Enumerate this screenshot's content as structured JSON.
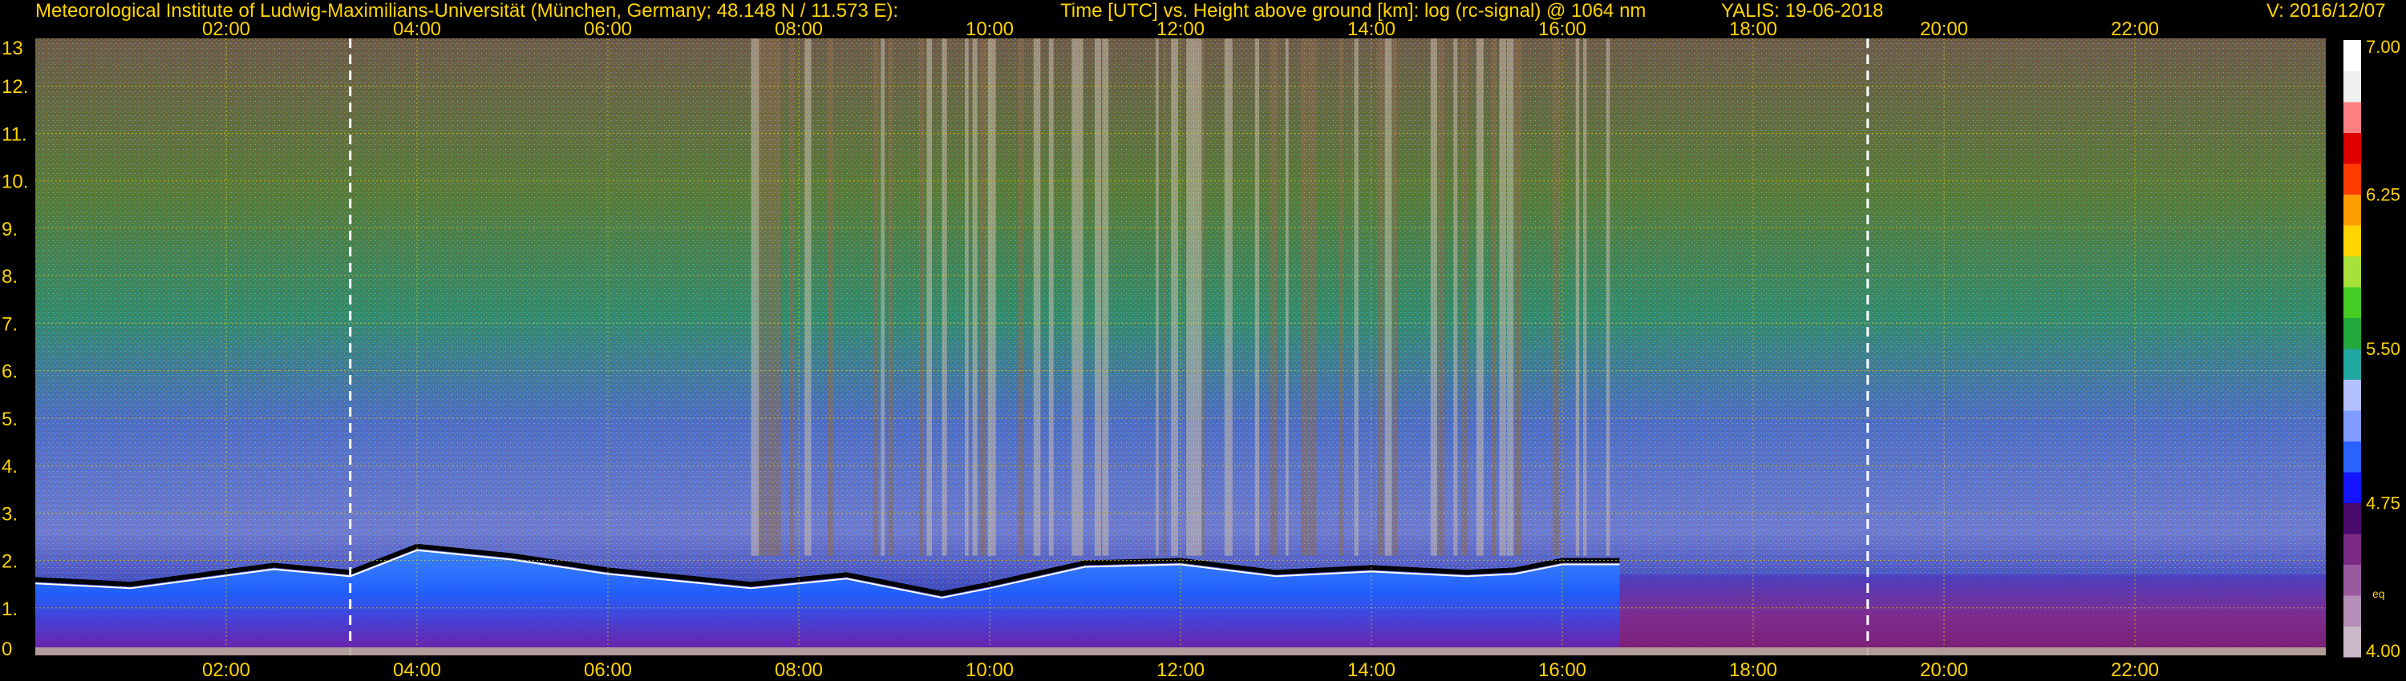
{
  "header": {
    "institute": "Meteorological Institute of Ludwig-Maximilians-Universität (München, Germany; 48.148 N / 11.573 E):",
    "description": "Time [UTC] vs. Height above ground [km]: log (rc-signal) @ 1064 nm",
    "instrument_date": "YALIS: 19-06-2018",
    "version": "V: 2016/12/07"
  },
  "colors": {
    "label": "#ffd400",
    "grid": "#d8c400",
    "marker": "#ffffff",
    "background": "#000000"
  },
  "chart_data": {
    "type": "heatmap",
    "title": "Time [UTC] vs. Height above ground [km]: log (rc-signal) @ 1064 nm",
    "x_unit": "hours UTC",
    "y_unit": "km",
    "x_range": [
      0,
      24
    ],
    "y_range": [
      0,
      13
    ],
    "x_tick_values": [
      2,
      4,
      6,
      8,
      10,
      12,
      14,
      16,
      18,
      20,
      22
    ],
    "x_tick_labels": [
      "02:00",
      "04:00",
      "06:00",
      "08:00",
      "10:00",
      "12:00",
      "14:00",
      "16:00",
      "18:00",
      "20:00",
      "22:00"
    ],
    "y_tick_values": [
      0,
      1,
      2,
      3,
      4,
      5,
      6,
      7,
      8,
      9,
      10,
      11,
      12,
      13
    ],
    "y_tick_labels": [
      "0",
      "1.",
      "2.",
      "3.",
      "4.",
      "5.",
      "6.",
      "7.",
      "8.",
      "9.",
      "10.",
      "11.",
      "12.",
      "13"
    ],
    "grid": true,
    "marker_lines_hours": [
      3.3,
      19.2
    ],
    "colorbar": {
      "range": [
        4.0,
        7.0
      ],
      "tick_values": [
        4.0,
        4.75,
        5.5,
        6.25,
        7.0
      ],
      "tick_labels": [
        "4.00",
        "4.75",
        "5.50",
        "6.25",
        "7.00"
      ],
      "note": "eq",
      "colors": [
        "#c9b8c9",
        "#b48eb8",
        "#9a5a9e",
        "#7a2a82",
        "#4a0a6e",
        "#1414ff",
        "#2a62ff",
        "#7f9bff",
        "#b3c0ff",
        "#20a8a0",
        "#21a83a",
        "#44cc22",
        "#a8e03a",
        "#ffd400",
        "#ff9c00",
        "#ff3b00",
        "#e00000",
        "#ff8080",
        "#f0f0f0",
        "#ffffff"
      ]
    },
    "boundary_layer_top_km": [
      [
        0.0,
        1.6
      ],
      [
        1.0,
        1.5
      ],
      [
        2.5,
        1.9
      ],
      [
        3.3,
        1.75
      ],
      [
        4.0,
        2.3
      ],
      [
        5.0,
        2.1
      ],
      [
        6.0,
        1.8
      ],
      [
        7.5,
        1.5
      ],
      [
        8.5,
        1.7
      ],
      [
        9.5,
        1.3
      ],
      [
        10.0,
        1.5
      ],
      [
        11.0,
        1.95
      ],
      [
        12.0,
        2.0
      ],
      [
        13.0,
        1.75
      ],
      [
        14.0,
        1.85
      ],
      [
        15.0,
        1.75
      ],
      [
        15.5,
        1.8
      ],
      [
        16.0,
        2.0
      ],
      [
        16.6,
        2.0
      ]
    ],
    "cloud_free_period_hours": [
      16.6,
      24
    ]
  }
}
